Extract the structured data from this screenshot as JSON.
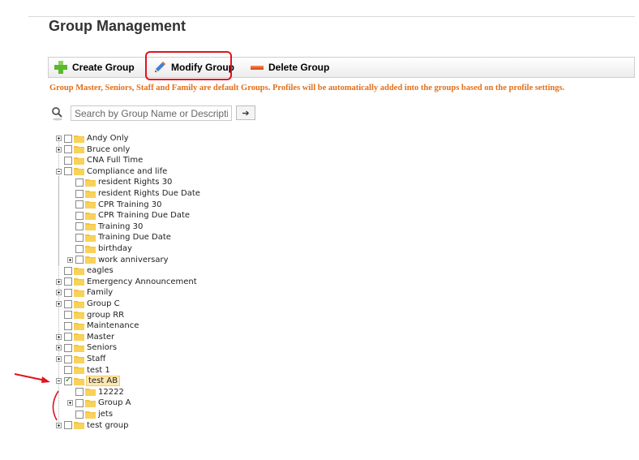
{
  "page_title": "Group Management",
  "toolbar": {
    "create_label": "Create Group",
    "modify_label": "Modify Group",
    "delete_label": "Delete Group"
  },
  "notice": "Group Master, Seniors, Staff and Family are default Groups. Profiles will be automatically added into the groups based on the profile settings.",
  "search": {
    "placeholder": "Search by Group Name or Description",
    "go_label": "➔"
  },
  "colors": {
    "notice": "#e2701a",
    "highlight": "#e0141e",
    "folder": "#f5c33b"
  },
  "tree": [
    {
      "label": "Andy Only",
      "expander": "plus",
      "checked": false
    },
    {
      "label": "Bruce only",
      "expander": "plus",
      "checked": false
    },
    {
      "label": "CNA Full Time",
      "expander": "none",
      "checked": false
    },
    {
      "label": "Compliance and life",
      "expander": "minus",
      "checked": false,
      "children": [
        {
          "label": "resident Rights 30",
          "expander": "none",
          "checked": false
        },
        {
          "label": "resident Rights Due Date",
          "expander": "none",
          "checked": false
        },
        {
          "label": "CPR Training 30",
          "expander": "none",
          "checked": false
        },
        {
          "label": "CPR Training Due Date",
          "expander": "none",
          "checked": false
        },
        {
          "label": "Training 30",
          "expander": "none",
          "checked": false
        },
        {
          "label": "Training Due Date",
          "expander": "none",
          "checked": false
        },
        {
          "label": "birthday",
          "expander": "none",
          "checked": false
        },
        {
          "label": "work anniversary",
          "expander": "plus",
          "checked": false
        }
      ]
    },
    {
      "label": "eagles",
      "expander": "none",
      "checked": false
    },
    {
      "label": "Emergency Announcement",
      "expander": "plus",
      "checked": false
    },
    {
      "label": "Family",
      "expander": "plus",
      "checked": false
    },
    {
      "label": "Group C",
      "expander": "plus",
      "checked": false
    },
    {
      "label": "group RR",
      "expander": "none",
      "checked": false
    },
    {
      "label": "Maintenance",
      "expander": "none",
      "checked": false
    },
    {
      "label": "Master",
      "expander": "plus",
      "checked": false
    },
    {
      "label": "Seniors",
      "expander": "plus",
      "checked": false
    },
    {
      "label": "Staff",
      "expander": "plus",
      "checked": false
    },
    {
      "label": "test 1",
      "expander": "none",
      "checked": false
    },
    {
      "label": "test AB",
      "expander": "minus",
      "checked": true,
      "selected": true,
      "children": [
        {
          "label": "12222",
          "expander": "none",
          "checked": false
        },
        {
          "label": "Group A",
          "expander": "plus",
          "checked": false
        },
        {
          "label": "jets",
          "expander": "none",
          "checked": false
        }
      ]
    },
    {
      "label": "test group",
      "expander": "plus",
      "checked": false
    }
  ]
}
